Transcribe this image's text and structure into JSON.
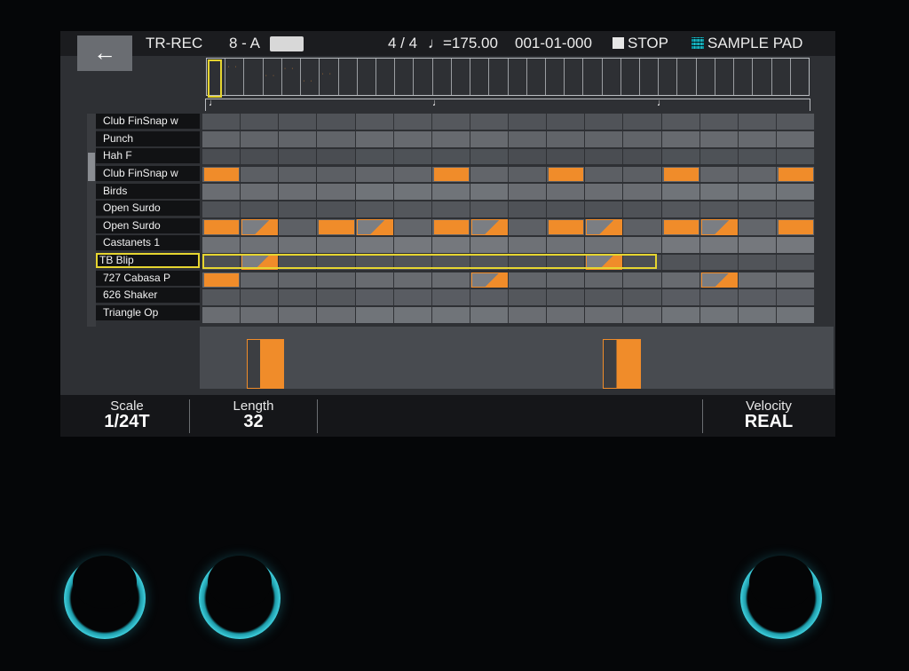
{
  "header": {
    "back_glyph": "←",
    "mode": "TR-REC",
    "pattern": "8 - A",
    "time_signature": "4 / 4",
    "tempo": "♩=175.00",
    "position": "001-01-000",
    "transport_state": "STOP",
    "pad_mode": "SAMPLE PAD"
  },
  "ruler": {
    "beat_glyph": "♩"
  },
  "instruments": [
    "Club FinSnap w",
    "Punch",
    "Hah F",
    "Club FinSnap w",
    "Birds",
    "Open Surdo",
    "Open Surdo",
    "Castanets 1",
    "TB Blip",
    "727 Cabasa P",
    "626 Shaker",
    "Triangle Op"
  ],
  "selected_instrument_index": 8,
  "sequencer": {
    "steps": 16,
    "notes": [
      {
        "row": 3,
        "steps": [
          0,
          6,
          9,
          12,
          15
        ],
        "style": "full"
      },
      {
        "row": 6,
        "steps": [
          0,
          3,
          6,
          9,
          12,
          15
        ],
        "style": "full"
      },
      {
        "row": 6,
        "steps": [
          1,
          4,
          7,
          10,
          13
        ],
        "style": "tri"
      },
      {
        "row": 8,
        "steps": [
          1,
          10
        ],
        "style": "tri"
      },
      {
        "row": 9,
        "steps": [
          0
        ],
        "style": "full"
      },
      {
        "row": 9,
        "steps": [
          7,
          13
        ],
        "style": "tri"
      }
    ]
  },
  "velocity_lane": {
    "bars_at_steps": [
      1,
      10
    ]
  },
  "footer": {
    "scale_label": "Scale",
    "scale_value": "1/24T",
    "length_label": "Length",
    "length_value": "32",
    "velocity_label": "Velocity",
    "velocity_value": "REAL"
  },
  "colors": {
    "accent_note": "#f08c2a",
    "selection": "#e6d530",
    "knob_ring": "#45d8e6"
  }
}
